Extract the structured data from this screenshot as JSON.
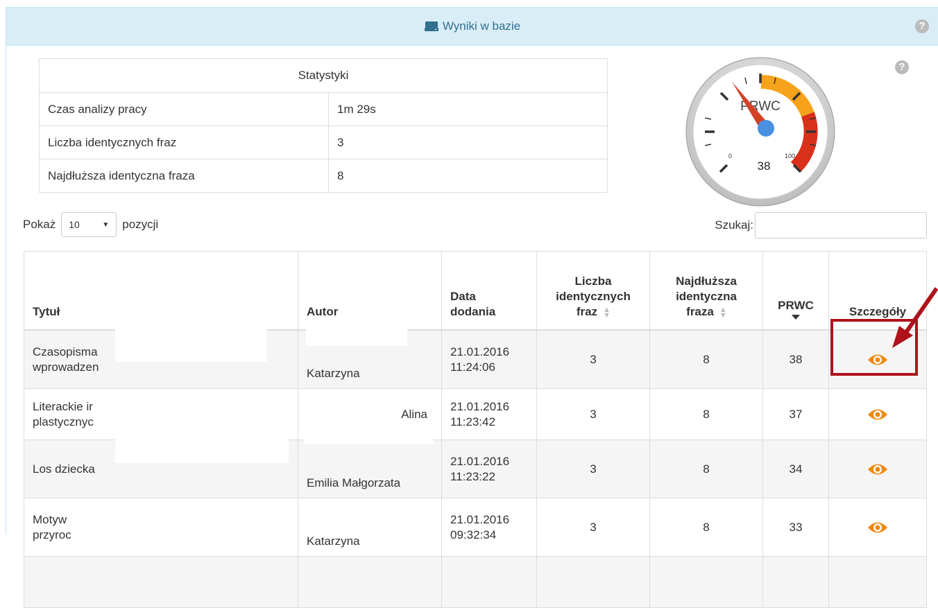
{
  "panel": {
    "title": "Wyniki w bazie"
  },
  "stats": {
    "header": "Statystyki",
    "rows": [
      {
        "label": "Czas analizy pracy",
        "value": "1m 29s"
      },
      {
        "label": "Liczba identycznych fraz",
        "value": "3"
      },
      {
        "label": "Najdłuższa identyczna fraza",
        "value": "8"
      }
    ]
  },
  "gauge": {
    "label": "PRWC",
    "value": "38",
    "min": "0",
    "max": "100"
  },
  "controls": {
    "show_label": "Pokaż",
    "show_value": "10",
    "entries_label": "pozycji",
    "search_label": "Szukaj:"
  },
  "table": {
    "headers": {
      "title": "Tytuł",
      "author": "Autor",
      "date_l1": "Data",
      "date_l2": "dodania",
      "count_l1": "Liczba",
      "count_l2": "identycznych",
      "count_l3": "fraz",
      "longest_l1": "Najdłuższa",
      "longest_l2": "identyczna",
      "longest_l3": "fraza",
      "prwc": "PRWC",
      "details": "Szczegóły"
    },
    "rows": [
      {
        "title_l1": "Czasopisma",
        "title_l2": "wprowadzen",
        "author": "Katarzyna",
        "date": "21.01.2016",
        "time": "11:24:06",
        "count": "3",
        "longest": "8",
        "prwc": "38"
      },
      {
        "title_l1": "Literackie ir",
        "title_l2": "plastycznyc",
        "author": "Alina",
        "date": "21.01.2016",
        "time": "11:23:42",
        "count": "3",
        "longest": "8",
        "prwc": "37"
      },
      {
        "title_l1": "Los dziecka",
        "title_l2": "",
        "author": "Emilia Małgorzata",
        "date": "21.01.2016",
        "time": "11:23:22",
        "count": "3",
        "longest": "8",
        "prwc": "34"
      },
      {
        "title_l1": "Motyw",
        "title_l2": "przyroc",
        "author": "Katarzyna",
        "date": "21.01.2016",
        "time": "09:32:34",
        "count": "3",
        "longest": "8",
        "prwc": "33"
      }
    ]
  },
  "colors": {
    "accent_eye": "#f0890c",
    "highlight": "#b0121b",
    "heading_bg": "#d9edf7"
  }
}
